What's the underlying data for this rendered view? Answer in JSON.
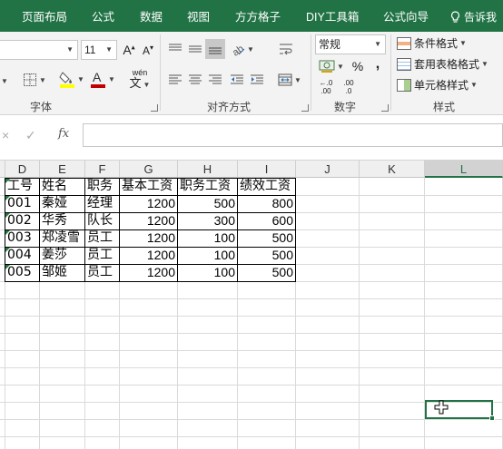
{
  "tabs": [
    "页面布局",
    "公式",
    "数据",
    "视图",
    "方方格子",
    "DIY工具箱",
    "公式向导"
  ],
  "tell_me": "告诉我",
  "ribbon": {
    "font_size": "11",
    "number_format": "常规",
    "group_labels": [
      "字体",
      "对齐方式",
      "数字",
      "样式"
    ],
    "styles": [
      "条件格式",
      "套用表格格式",
      "单元格样式"
    ],
    "percent": "%",
    "comma": ",",
    "inc_decimal": ".00",
    "dec_decimal": ".0",
    "phonetic": "wén"
  },
  "formula_bar": {
    "cancel": "×",
    "enter": "✓",
    "fx": "fx"
  },
  "columns": [
    "D",
    "E",
    "F",
    "G",
    "H",
    "I",
    "J",
    "K",
    "L"
  ],
  "selected_column": "L",
  "table": {
    "headers": [
      "工号",
      "姓名",
      "职务",
      "基本工资",
      "职务工资",
      "绩效工资"
    ],
    "rows": [
      [
        "001",
        "秦娅",
        "经理",
        "1200",
        "500",
        "800"
      ],
      [
        "002",
        "华秀",
        "队长",
        "1200",
        "300",
        "600"
      ],
      [
        "003",
        "郑凌雪",
        "员工",
        "1200",
        "100",
        "500"
      ],
      [
        "004",
        "姜莎",
        "员工",
        "1200",
        "100",
        "500"
      ],
      [
        "005",
        "邹姬",
        "员工",
        "1200",
        "100",
        "500"
      ]
    ]
  },
  "colors": {
    "ribbon_green": "#217346",
    "font_color": "#c00000",
    "fill_color": "#ffff00"
  }
}
